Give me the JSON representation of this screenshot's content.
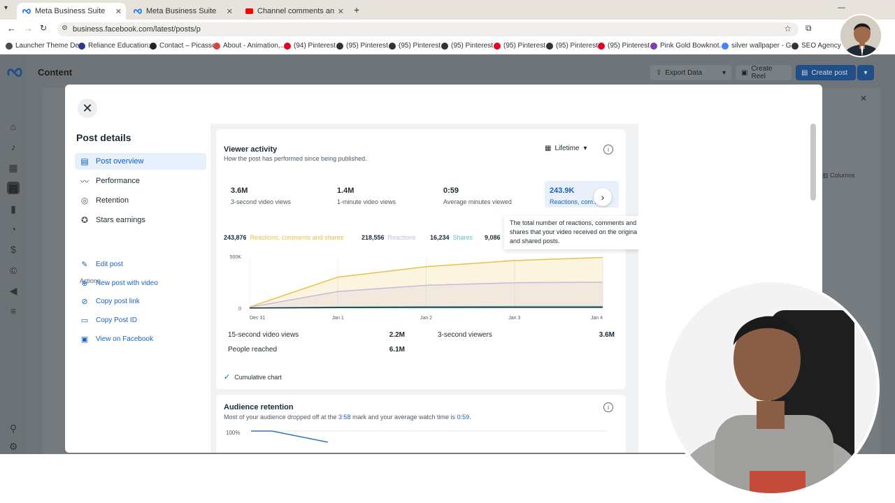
{
  "browser": {
    "tabs": [
      {
        "title": "Meta Business Suite",
        "active": true
      },
      {
        "title": "Meta Business Suite",
        "active": false
      },
      {
        "title": "Channel comments and mentio",
        "active": false
      }
    ],
    "url": "business.facebook.com/latest/posts/p",
    "bookmarks": [
      {
        "label": "Launcher Theme De...",
        "color": "#4a4a4a"
      },
      {
        "label": "Reliance Education:...",
        "color": "#2b3a8a"
      },
      {
        "label": "Contact – Picasso",
        "color": "#222222"
      },
      {
        "label": "About - Animation,...",
        "color": "#d6463c"
      },
      {
        "label": "(94) Pinterest",
        "color": "#e60023"
      },
      {
        "label": "(95) Pinterest",
        "color": "#333333"
      },
      {
        "label": "(95) Pinterest",
        "color": "#333333"
      },
      {
        "label": "(95) Pinterest",
        "color": "#333333"
      },
      {
        "label": "(95) Pinterest",
        "color": "#e60023"
      },
      {
        "label": "(95) Pinterest",
        "color": "#333333"
      },
      {
        "label": "(95) Pinterest",
        "color": "#e60023"
      },
      {
        "label": "Pink Gold Bowknot...",
        "color": "#7b3fb0"
      },
      {
        "label": "silver wallpaper - G...",
        "color": "#4285f4"
      },
      {
        "label": "SEO Agency Ind",
        "color": "#333333"
      }
    ]
  },
  "app": {
    "title": "Content",
    "export_label": "Export Data",
    "create_reel_label": "Create Reel",
    "create_post_label": "Create post",
    "columns_label": "Columns"
  },
  "modal": {
    "sidebar_title": "Post details",
    "nav": [
      {
        "label": "Post overview",
        "icon": "post-overview-icon",
        "active": true
      },
      {
        "label": "Performance",
        "icon": "performance-icon",
        "active": false
      },
      {
        "label": "Retention",
        "icon": "retention-icon",
        "active": false
      },
      {
        "label": "Stars earnings",
        "icon": "stars-icon",
        "active": false
      }
    ],
    "actions_label": "Actions",
    "actions": [
      {
        "label": "Edit post",
        "icon": "edit-icon"
      },
      {
        "label": "New post with video",
        "icon": "plus-icon"
      },
      {
        "label": "Copy post link",
        "icon": "link-icon"
      },
      {
        "label": "Copy Post ID",
        "icon": "id-icon"
      },
      {
        "label": "View on Facebook",
        "icon": "facebook-icon"
      }
    ],
    "viewer_activity": {
      "title": "Viewer activity",
      "subtitle": "How the post has performed since being published.",
      "range_label": "Lifetime",
      "metrics": [
        {
          "value": "3.6M",
          "label": "3-second video views"
        },
        {
          "value": "1.4M",
          "label": "1-minute video views"
        },
        {
          "value": "0:59",
          "label": "Average minutes viewed"
        },
        {
          "value": "243.9K",
          "label": "Reactions, com... a"
        }
      ],
      "tooltip": "The total number of reactions, comments and shares that your video received on the origina and shared posts.",
      "legend": [
        {
          "number": "243,876",
          "label": "Reactions, comments and shares",
          "color": "#e7c14a"
        },
        {
          "number": "218,556",
          "label": "Reactions",
          "color": "#c9b8dd"
        },
        {
          "number": "16,234",
          "label": "Shares",
          "color": "#61c3c9"
        },
        {
          "number": "9,086",
          "label": "",
          "color": "#1c2b33"
        }
      ],
      "stats": [
        {
          "label": "15-second video views",
          "value": "2.2M"
        },
        {
          "label": "3-second viewers",
          "value": "3.6M"
        },
        {
          "label": "People reached",
          "value": "6.1M"
        }
      ],
      "cumulative_label": "Cumulative chart"
    },
    "audience_retention": {
      "title": "Audience retention",
      "subtitle_pre": "Most of your audience dropped off at the ",
      "subtitle_mark": "3:58",
      "subtitle_mid": " mark and your average watch time is ",
      "subtitle_time": "0:59",
      "subtitle_end": ".",
      "ytick": "100%"
    }
  },
  "chart_data": {
    "type": "area",
    "x": [
      "Dec 31",
      "Jan 1",
      "Jan 2",
      "Jan 3",
      "Jan 4"
    ],
    "yticks": [
      "500K",
      "0"
    ],
    "ylim": [
      0,
      500000
    ],
    "series": [
      {
        "name": "Reactions, comments and shares",
        "color": "#e7c14a",
        "values": [
          10000,
          300000,
          400000,
          460000,
          490000
        ]
      },
      {
        "name": "Reactions",
        "color": "#c9b8dd",
        "values": [
          8000,
          160000,
          220000,
          245000,
          250000
        ]
      },
      {
        "name": "Shares",
        "color": "#61c3c9",
        "values": [
          1000,
          10000,
          14000,
          16000,
          16234
        ]
      },
      {
        "name": "",
        "color": "#1c2b33",
        "values": [
          500,
          5000,
          7500,
          8800,
          9086
        ]
      }
    ]
  }
}
